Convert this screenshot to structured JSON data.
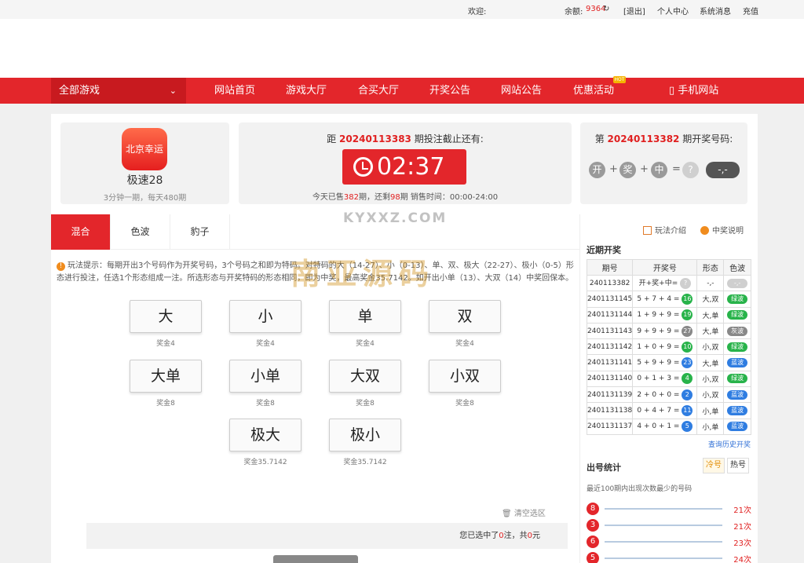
{
  "topbar": {
    "welcome": "欢迎:",
    "balance_label": "余额:",
    "balance": "9364",
    "refresh": "↻",
    "logout": "[退出]",
    "user_center": "个人中心",
    "messages": "系统消息",
    "recharge": "充值"
  },
  "nav": {
    "all_games": "全部游戏",
    "chevron": "⌄",
    "items": [
      "网站首页",
      "游戏大厅",
      "合买大厅",
      "开奖公告",
      "网站公告",
      "优惠活动",
      "手机网站"
    ],
    "hot_badge": "HOT"
  },
  "game": {
    "logo_text": "北京幸运",
    "name": "极速28",
    "desc": "3分钟一期，每天480期"
  },
  "deadline": {
    "prefix": "距",
    "period": "20240113383",
    "suffix": "期投注截止还有:",
    "time": "02:37",
    "sold_pre": "今天已售",
    "sold": "382",
    "sold_mid": "期，还剩",
    "remain": "98",
    "sold_post": "期 销售时间：00:00-24:00"
  },
  "result": {
    "prefix": "第",
    "period": "20240113382",
    "suffix": "期开奖号码:",
    "balls": [
      "开",
      "奖",
      "中",
      "?"
    ],
    "ops": [
      "+",
      "+",
      "=",
      ""
    ],
    "pill": "-,-"
  },
  "tabs": [
    "混合",
    "色波",
    "豹子"
  ],
  "tip": "玩法提示：每期开出3个号码作为开奖号码，3个号码之和即为特码。对特码的大（14-27）、小（0-13）、单、双、极大（22-27）、极小（0-5）形态进行投注，任选1个形态组成一注。所选形态与开奖特码的形态相同，即为中奖，最高奖金35.7142。如开出小单（13）、大双（14）中奖回保本。",
  "bets": [
    {
      "label": "大",
      "prize": "奖金4"
    },
    {
      "label": "小",
      "prize": "奖金4"
    },
    {
      "label": "单",
      "prize": "奖金4"
    },
    {
      "label": "双",
      "prize": "奖金4"
    },
    {
      "label": "大单",
      "prize": "奖金8"
    },
    {
      "label": "小单",
      "prize": "奖金8"
    },
    {
      "label": "大双",
      "prize": "奖金8"
    },
    {
      "label": "小双",
      "prize": "奖金8"
    },
    {
      "label": "极大",
      "prize": "奖金35.7142"
    },
    {
      "label": "极小",
      "prize": "奖金35.7142"
    }
  ],
  "clear_label": "清空选区",
  "summary": {
    "pre": "您已选中了",
    "count": "0",
    "mid": "注，共",
    "amount": "0",
    "post": "元"
  },
  "side": {
    "rules": "玩法介绍",
    "prize_info": "中奖说明",
    "recent_title": "近期开奖",
    "headers": [
      "期号",
      "开奖号",
      "形态",
      "色波"
    ],
    "history": [
      {
        "period": "240113382",
        "nums": "开+奖+中=",
        "sum": "?",
        "shape": "-,-",
        "wave": "-,-",
        "color": "#cfcfcf"
      },
      {
        "period": "2401131145",
        "nums": "5 + 7 + 4 =",
        "sum": "16",
        "shape": "大,双",
        "wave": "绿波",
        "color": "#28b34a"
      },
      {
        "period": "2401131144",
        "nums": "1 + 9 + 9 =",
        "sum": "19",
        "shape": "大,单",
        "wave": "绿波",
        "color": "#28b34a"
      },
      {
        "period": "2401131143",
        "nums": "9 + 9 + 9 =",
        "sum": "27",
        "shape": "大,单",
        "wave": "灰波",
        "color": "#888888"
      },
      {
        "period": "2401131142",
        "nums": "1 + 0 + 9 =",
        "sum": "10",
        "shape": "小,双",
        "wave": "绿波",
        "color": "#28b34a"
      },
      {
        "period": "2401131141",
        "nums": "5 + 9 + 9 =",
        "sum": "23",
        "shape": "大,单",
        "wave": "蓝波",
        "color": "#2f7de1"
      },
      {
        "period": "2401131140",
        "nums": "0 + 1 + 3 =",
        "sum": "4",
        "shape": "小,双",
        "wave": "绿波",
        "color": "#28b34a"
      },
      {
        "period": "2401131139",
        "nums": "2 + 0 + 0 =",
        "sum": "2",
        "shape": "小,双",
        "wave": "蓝波",
        "color": "#2f7de1"
      },
      {
        "period": "2401131138",
        "nums": "0 + 4 + 7 =",
        "sum": "11",
        "shape": "小,单",
        "wave": "蓝波",
        "color": "#2f7de1"
      },
      {
        "period": "2401131137",
        "nums": "4 + 0 + 1 =",
        "sum": "5",
        "shape": "小,单",
        "wave": "蓝波",
        "color": "#2f7de1"
      }
    ],
    "more": "查询历史开奖",
    "stats_title": "出号统计",
    "cold": "冷号",
    "hot": "热号",
    "stats_desc": "最近100期内出现次数最少的号码",
    "stats": [
      {
        "num": "8",
        "count": "21次"
      },
      {
        "num": "3",
        "count": "21次"
      },
      {
        "num": "6",
        "count": "23次"
      },
      {
        "num": "5",
        "count": "24次"
      }
    ]
  },
  "watermark": {
    "main": "南亚源码",
    "sub": "KYXXZ.COM"
  }
}
